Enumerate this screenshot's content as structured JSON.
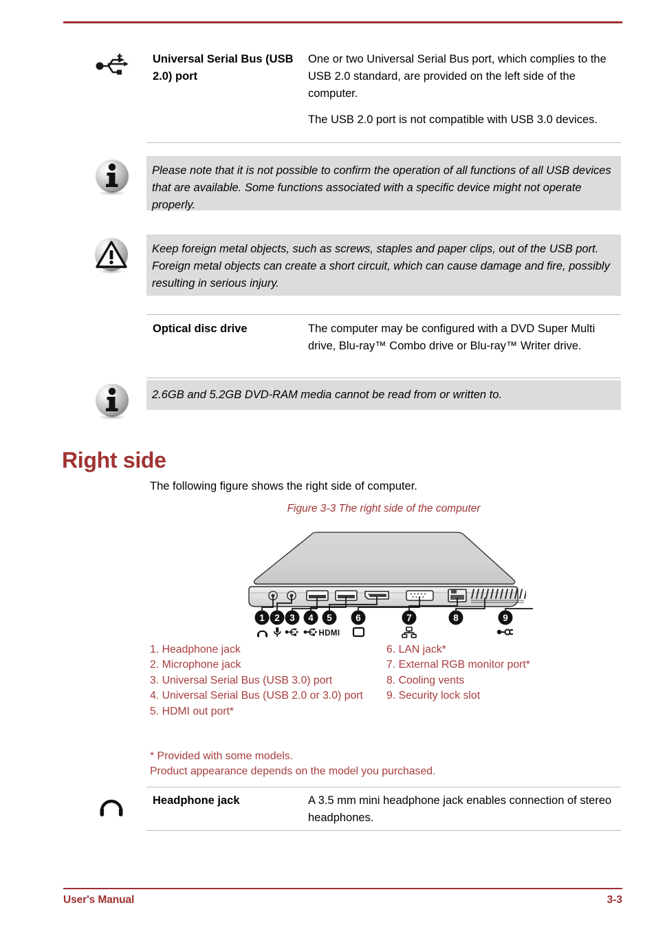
{
  "document": {
    "footer_left": "User's Manual",
    "page_number": "3-3",
    "accent_color": "#9e2f2f",
    "heading_color": "#a03333",
    "legend_color": "#a83c3c",
    "note_bg_color": "#dcdcdc"
  },
  "entries": [
    {
      "icon": "usb-icon",
      "term": "Universal Serial Bus (USB 2.0) port",
      "paragraphs": [
        "One or two Universal Serial Bus port, which complies to the USB 2.0 standard, are provided on the left side of the computer.",
        "The USB 2.0 port is not compatible with USB 3.0 devices."
      ]
    },
    {
      "icon": "none",
      "term": "Optical disc drive",
      "paragraphs": [
        "The computer may be configured with a DVD Super Multi drive, Blu-ray™ Combo drive or Blu-ray™ Writer drive."
      ]
    },
    {
      "icon": "headphone-icon",
      "term": "Headphone jack",
      "paragraphs": [
        "A 3.5 mm mini headphone jack enables connection of stereo headphones."
      ]
    }
  ],
  "notes": [
    {
      "icon": "info-icon",
      "text": "Please note that it is not possible to confirm the operation of all functions of all USB devices that are available. Some functions associated with a specific device might not operate properly."
    },
    {
      "icon": "warning-icon",
      "text": "Keep foreign metal objects, such as screws, staples and paper clips, out of the USB port. Foreign metal objects can create a short circuit, which can cause damage and fire, possibly resulting in serious injury."
    },
    {
      "icon": "info-icon",
      "text": "2.6GB and 5.2GB DVD-RAM media cannot be read from or written to."
    }
  ],
  "section": {
    "heading": "Right side",
    "intro": "The following figure shows the right side of computer.",
    "figure_caption": "Figure 3-3 The right side of the computer"
  },
  "figure": {
    "callouts": [
      {
        "number": "1",
        "icon": "headphone-jack-icon"
      },
      {
        "number": "2",
        "icon": "microphone-jack-icon"
      },
      {
        "number": "3",
        "icon": "usb-port-icon"
      },
      {
        "number": "4",
        "icon": "usb-port-icon"
      },
      {
        "number": "5",
        "icon": "hdmi-icon",
        "label": "HDMI"
      },
      {
        "number": "6",
        "icon": "monitor-icon"
      },
      {
        "number": "7",
        "icon": "lan-icon"
      },
      {
        "number": "8",
        "icon": "none"
      },
      {
        "number": "9",
        "icon": "security-lock-icon"
      }
    ]
  },
  "legend": {
    "left_column": [
      "1. Headphone jack",
      "2. Microphone jack",
      "3. Universal Serial Bus (USB 3.0) port",
      "4. Universal Serial Bus (USB 2.0 or 3.0) port",
      "5. HDMI out port*"
    ],
    "right_column": [
      "6. LAN jack*",
      "7. External RGB monitor port*",
      "8. Cooling vents",
      "9. Security lock slot"
    ],
    "footnotes": [
      "* Provided with some models.",
      "Product appearance depends on the model you purchased."
    ]
  }
}
